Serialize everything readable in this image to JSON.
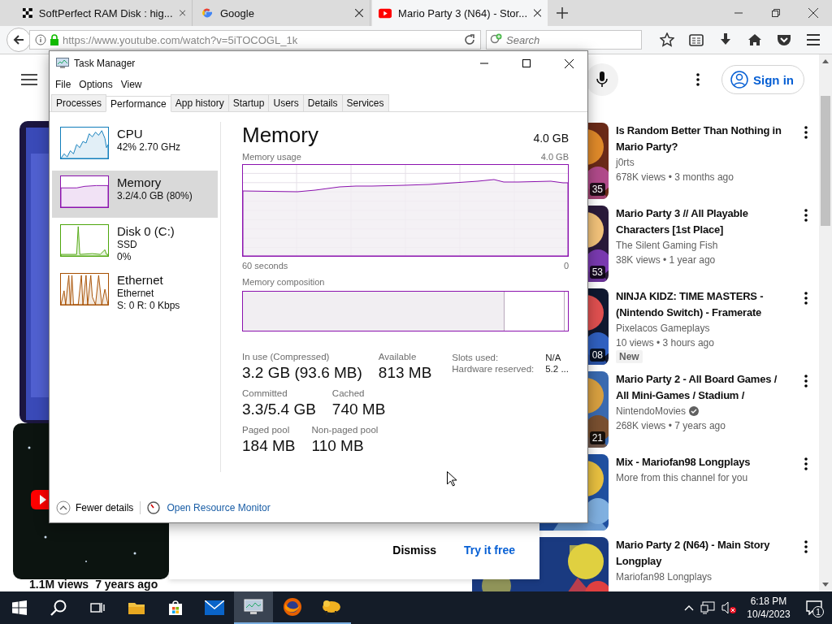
{
  "browser": {
    "tabs": [
      {
        "title": "SoftPerfect RAM Disk : hig...",
        "selected": false
      },
      {
        "title": "Google",
        "selected": false
      },
      {
        "title": "Mario Party 3 (N64) - Stor...",
        "selected": true
      }
    ],
    "url": "https://www.youtube.com/watch?v=5iTOCOGL_1k",
    "search": {
      "placeholder": "Search"
    }
  },
  "youtube": {
    "sign_in": "Sign in",
    "video": {
      "views": "1.1M views",
      "age": "7 years ago"
    },
    "promo": {
      "buttons": [
        "Dismiss",
        "Try it free"
      ]
    },
    "recommendations": [
      {
        "title": "Is Random Better Than Nothing in Mario Party?",
        "channel": "j0rts",
        "verified": false,
        "meta": "678K views • 3 months ago",
        "duration": "35"
      },
      {
        "title": "Mario Party 3 // All Playable Characters [1st Place]",
        "channel": "The Silent Gaming Fish",
        "verified": false,
        "meta": "38K views • 1 year ago",
        "duration": "53"
      },
      {
        "title": "NINJA KIDZ: TIME MASTERS - (Nintendo Switch) - Framerate",
        "channel": "Pixelacos Gameplays",
        "verified": false,
        "meta": "10 views • 3 hours ago",
        "badge": "New",
        "duration": "08"
      },
      {
        "title": "Mario Party 2 - All Board Games / All Mini-Games / Stadium /",
        "channel": "NintendoMovies",
        "verified": true,
        "meta": "268K views • 7 years ago",
        "duration": "21"
      },
      {
        "title": "Mix - Mariofan98 Longplays",
        "channel": "More from this channel for you",
        "verified": false
      },
      {
        "title": "Mario Party 2 (N64) - Main Story Longplay",
        "channel": "Mariofan98 Longplays",
        "verified": false
      }
    ]
  },
  "task_manager": {
    "title": "Task Manager",
    "menu": [
      "File",
      "Options",
      "View"
    ],
    "tabs": [
      {
        "label": "Processes",
        "selected": false
      },
      {
        "label": "Performance",
        "selected": true
      },
      {
        "label": "App history",
        "selected": false
      },
      {
        "label": "Startup",
        "selected": false
      },
      {
        "label": "Users",
        "selected": false
      },
      {
        "label": "Details",
        "selected": false
      },
      {
        "label": "Services",
        "selected": false
      }
    ],
    "resources": [
      {
        "kind": "cpu",
        "name": "CPU",
        "lines": [
          "42% 2.70 GHz"
        ],
        "color": "#117dbb",
        "selected": false
      },
      {
        "kind": "memory",
        "name": "Memory",
        "lines": [
          "3.2/4.0 GB (80%)"
        ],
        "color": "#8b12ae",
        "selected": true
      },
      {
        "kind": "disk",
        "name": "Disk 0 (C:)",
        "lines": [
          "SSD",
          "0%"
        ],
        "color": "#4da60c",
        "selected": false
      },
      {
        "kind": "ethernet",
        "name": "Ethernet",
        "lines": [
          "Ethernet",
          "S: 0 R: 0 Kbps"
        ],
        "color": "#a74f01",
        "selected": false
      }
    ],
    "detail": {
      "title": "Memory",
      "total": "4.0 GB",
      "usage_label": "Memory usage",
      "usage_max": "4.0 GB",
      "x_start": "60 seconds",
      "x_end": "0",
      "composition_label": "Memory composition",
      "composition": {
        "level": 0.805
      },
      "stats": [
        [
          {
            "label": "In use (Compressed)",
            "value": "3.2 GB (93.6 MB)"
          },
          {
            "label": "Available",
            "value": "813 MB"
          }
        ],
        [
          {
            "label": "Committed",
            "value": "3.3/5.4 GB"
          },
          {
            "label": "Cached",
            "value": "740 MB"
          }
        ],
        [
          {
            "label": "Paged pool",
            "value": "184 MB"
          },
          {
            "label": "Non-paged pool",
            "value": "110 MB"
          }
        ]
      ],
      "info": [
        {
          "label": "Slots used:",
          "value": "N/A"
        },
        {
          "label": "Hardware reserved:",
          "value": "5.2 ..."
        }
      ]
    },
    "footer": {
      "fewer": "Fewer details",
      "monitor": "Open Resource Monitor"
    }
  },
  "taskbar": {
    "apps": [
      {
        "running": false,
        "selected": false
      },
      {
        "running": false,
        "selected": false
      },
      {
        "running": false,
        "selected": false
      },
      {
        "running": true,
        "selected": true
      },
      {
        "running": true,
        "selected": false
      },
      {
        "running": true,
        "selected": false
      }
    ],
    "time": "6:18 PM",
    "date": "10/4/2023",
    "notifications": "1"
  }
}
